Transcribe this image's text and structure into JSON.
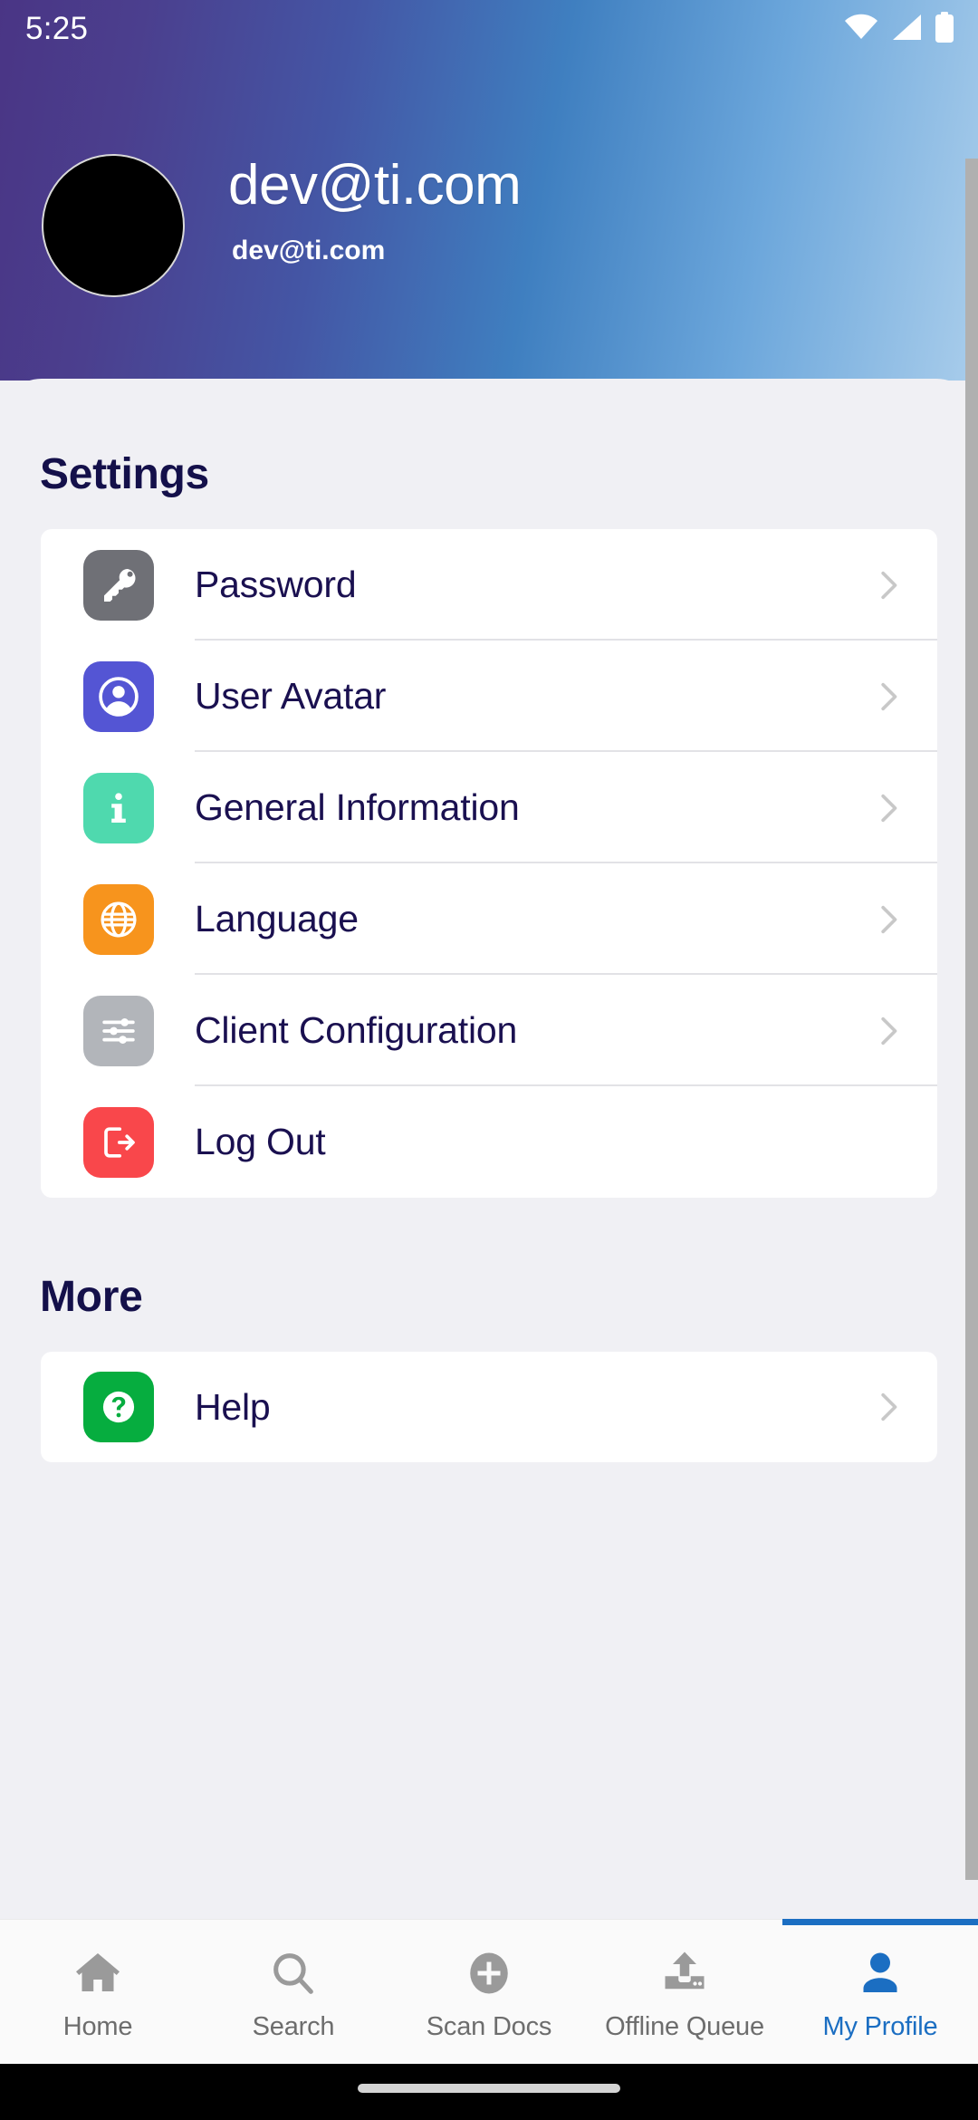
{
  "status_bar": {
    "time": "5:25",
    "icons": [
      "wifi-icon",
      "cellular-signal-icon",
      "battery-icon"
    ]
  },
  "profile": {
    "avatar_icon": "user-avatar",
    "name": "dev@ti.com",
    "email": "dev@ti.com"
  },
  "settings_section": {
    "title": "Settings",
    "items": [
      {
        "label": "Password",
        "icon": "key-icon",
        "icon_color": "#6f7076"
      },
      {
        "label": "User Avatar",
        "icon": "account-icon",
        "icon_color": "#5455d4"
      },
      {
        "label": "General Information",
        "icon": "info-icon",
        "icon_color": "#4fd9ae"
      },
      {
        "label": "Language",
        "icon": "globe-icon",
        "icon_color": "#f7941d"
      },
      {
        "label": "Client Configuration",
        "icon": "sliders-icon",
        "icon_color": "#b2b5ba"
      },
      {
        "label": "Log Out",
        "icon": "logout-icon",
        "icon_color": "#f9474b"
      }
    ]
  },
  "more_section": {
    "title": "More",
    "items": [
      {
        "label": "Help",
        "icon": "help-circle-icon",
        "icon_color": "#06ad3f"
      }
    ]
  },
  "bottom_nav": {
    "active_color": "#1b6ec2",
    "inactive_color": "#9a9a9a",
    "tabs": [
      {
        "label": "Home",
        "icon": "home-icon",
        "active": false
      },
      {
        "label": "Search",
        "icon": "search-icon",
        "active": false
      },
      {
        "label": "Scan Docs",
        "icon": "plus-circle-icon",
        "active": false
      },
      {
        "label": "Offline Queue",
        "icon": "upload-tray-icon",
        "active": false
      },
      {
        "label": "My Profile",
        "icon": "person-icon",
        "active": true
      }
    ]
  }
}
